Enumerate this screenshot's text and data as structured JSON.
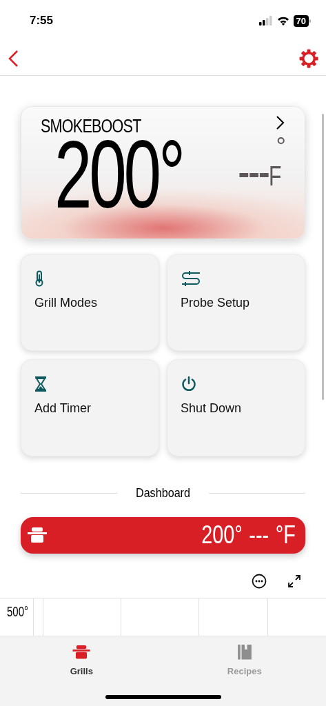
{
  "status_bar": {
    "time": "7:55",
    "battery": "70"
  },
  "grill_card": {
    "mode": "SMOKEBOOST",
    "set_temp": "200°",
    "probe_degree": "°",
    "probe_temp": "---",
    "unit": "F"
  },
  "actions": [
    {
      "label": "Grill Modes",
      "kind": "thermometer"
    },
    {
      "label": "Probe Setup",
      "kind": "probe"
    },
    {
      "label": "Add Timer",
      "kind": "hourglass"
    },
    {
      "label": "Shut Down",
      "kind": "power"
    }
  ],
  "dashboard": {
    "title": "Dashboard",
    "grill_temp": "200°",
    "probe_temp": "---",
    "unit": "°F"
  },
  "chart": {
    "y_label": "500°"
  },
  "tabs": [
    {
      "label": "Grills",
      "kind": "grill",
      "selected": true
    },
    {
      "label": "Recipes",
      "kind": "book",
      "selected": false
    }
  ]
}
